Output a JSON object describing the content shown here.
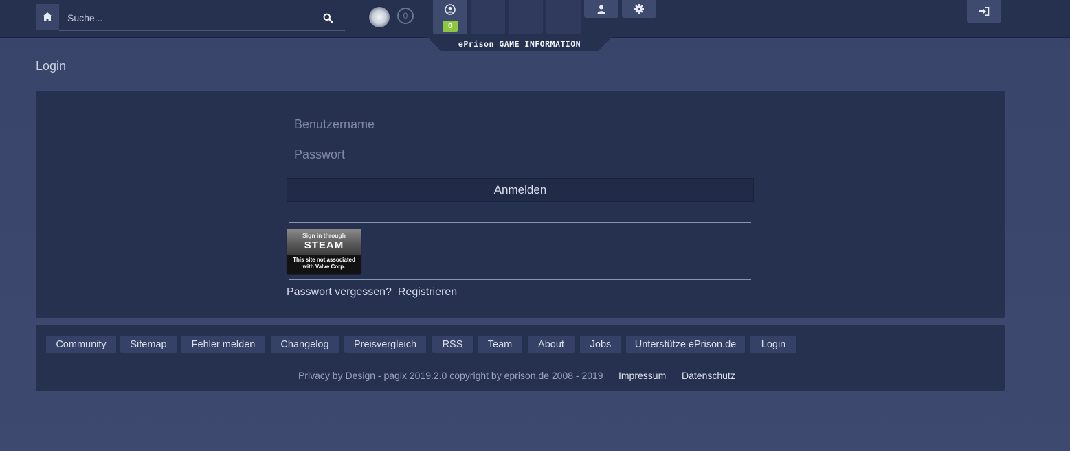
{
  "header": {
    "search": {
      "placeholder": "Suche..."
    },
    "notifications": {
      "count": "0"
    },
    "slots": [
      {
        "icon": "user-circle-icon",
        "badge": "0"
      },
      {
        "icon": ""
      },
      {
        "icon": ""
      },
      {
        "icon": ""
      }
    ],
    "info_tab_label": "ePrison GAME INFORMATION",
    "icons": {
      "home": "home-icon",
      "search": "search-icon",
      "user": "user-icon",
      "settings": "gear-icon",
      "logout": "sign-in-icon"
    },
    "accent_badge_color": "#8dc63f"
  },
  "main": {
    "title": "Login",
    "form": {
      "username_placeholder": "Benutzername",
      "password_placeholder": "Passwort",
      "submit_label": "Anmelden"
    },
    "steam": {
      "line1": "Sign in through",
      "line2": "STEAM",
      "line3": "This site not associated",
      "line4": "with Valve Corp."
    },
    "links": {
      "forgot": "Passwort vergessen?",
      "register": "Registrieren"
    }
  },
  "footer": {
    "links": [
      "Community",
      "Sitemap",
      "Fehler melden",
      "Changelog",
      "Preisvergleich",
      "RSS",
      "Team",
      "About",
      "Jobs",
      "Unterstütze ePrison.de",
      "Login"
    ],
    "copyright": "Privacy by Design - pagix 2019.2.0 copyright by eprison.de 2008 - 2019",
    "impressum": "Impressum",
    "datenschutz": "Datenschutz"
  },
  "colors": {
    "background": "#3a466c",
    "panel": "#263150",
    "button": "#354166"
  }
}
